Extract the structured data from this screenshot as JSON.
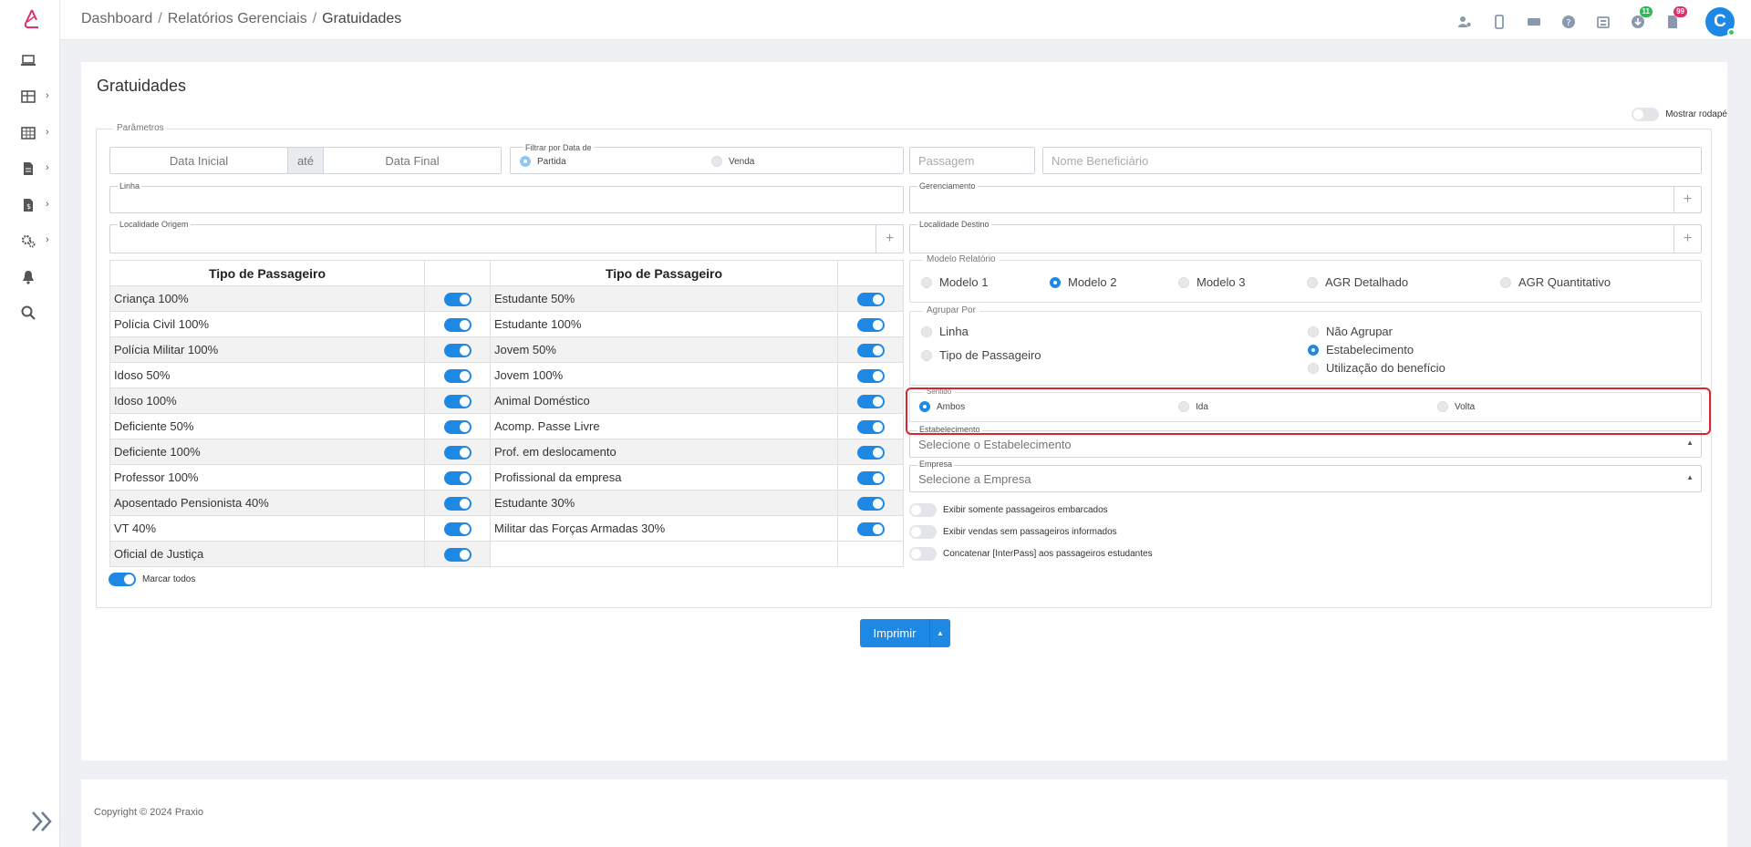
{
  "breadcrumb": {
    "home": "Dashboard",
    "section": "Relatórios Gerenciais",
    "current": "Gratuidades",
    "sep": "/"
  },
  "page_title": "Gratuidades",
  "top_badges": {
    "downloads": "11",
    "docs": "99"
  },
  "user": {
    "initial": "C"
  },
  "footer_toggle_label": "Mostrar rodapé",
  "params": {
    "legend": "Parâmetros",
    "data_inicial": "Data Inicial",
    "ate": "até",
    "data_final": "Data Final",
    "filtrar_legend": "Filtrar por Data de",
    "filtrar_partida": "Partida",
    "filtrar_venda": "Venda",
    "passagem": "Passagem",
    "nome_beneficiario": "Nome Beneficiário",
    "linha": "Linha",
    "gerenciamento": "Gerenciamento",
    "localidade_origem": "Localidade Origem",
    "localidade_destino": "Localidade Destino",
    "plus": "+"
  },
  "table_header": "Tipo de Passageiro",
  "left_table": [
    "Criança 100%",
    "Polícia Civil 100%",
    "Polícia Militar 100%",
    "Idoso 50%",
    "Idoso 100%",
    "Deficiente 50%",
    "Deficiente 100%",
    "Professor 100%",
    "Aposentado Pensionista 40%",
    "VT 40%",
    "Oficial de Justiça"
  ],
  "right_table": [
    "Estudante 50%",
    "Estudante 100%",
    "Jovem 50%",
    "Jovem 100%",
    "Animal Doméstico",
    "Acomp. Passe Livre",
    "Prof. em deslocamento",
    "Profissional da empresa",
    "Estudante 30%",
    "Militar das Forças Armadas 30%"
  ],
  "marcar_todos": "Marcar todos",
  "modelo": {
    "legend": "Modelo Relatório",
    "options": [
      "Modelo 1",
      "Modelo 2",
      "Modelo 3",
      "AGR Detalhado",
      "AGR Quantitativo"
    ],
    "selected": "Modelo 2"
  },
  "agrupar": {
    "legend": "Agrupar Por",
    "linha": "Linha",
    "tipo": "Tipo de Passageiro",
    "nao_agrupar": "Não Agrupar",
    "estabelecimento": "Estabelecimento",
    "utilizacao": "Utilização do benefício",
    "selected": "Estabelecimento"
  },
  "sentido": {
    "legend": "Sentido",
    "ambos": "Ambos",
    "ida": "Ida",
    "volta": "Volta",
    "selected": "Ambos"
  },
  "estabelecimento": {
    "legend": "Estabelecimento",
    "placeholder": "Selecione o Estabelecimento"
  },
  "empresa": {
    "legend": "Empresa",
    "placeholder": "Selecione a Empresa"
  },
  "switches": [
    "Exibir somente passageiros embarcados",
    "Exibir vendas sem passageiros informados",
    "Concatenar [InterPass] aos passageiros estudantes"
  ],
  "print_button": "Imprimir",
  "copyright": "Copyright © 2024 Praxio",
  "colors": {
    "accent": "#1e88e5",
    "highlight": "#d9262c",
    "brand": "#e0306d"
  }
}
